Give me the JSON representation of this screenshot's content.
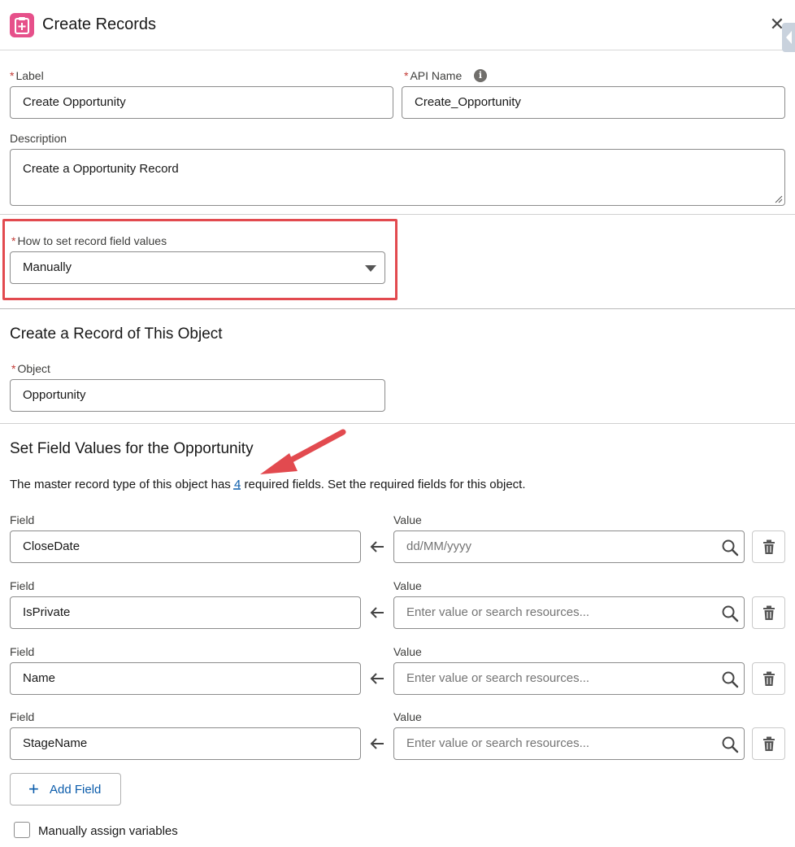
{
  "header": {
    "title": "Create Records",
    "close_symbol": "✕",
    "icon": "create-record-icon",
    "icon_color": "#e6508a"
  },
  "general": {
    "label_field": {
      "label": "Label",
      "value": "Create Opportunity"
    },
    "api_name_field": {
      "label": "API Name",
      "value": "Create_Opportunity",
      "info_icon": "i"
    },
    "description_field": {
      "label": "Description",
      "value": "Create a Opportunity Record"
    },
    "required_marker": "*"
  },
  "how_to_set": {
    "label": "How to set record field values",
    "selected": "Manually",
    "highlight_color": "#e24a4f"
  },
  "object_section": {
    "title": "Create a Record of This Object",
    "object_field": {
      "label": "Object",
      "value": "Opportunity"
    }
  },
  "field_values_section": {
    "title": "Set Field Values for the Opportunity",
    "info_before": "The master record type of this object has ",
    "info_count": "4",
    "info_after": " required fields. Set the required fields for this object.",
    "field_label": "Field",
    "value_label": "Value",
    "rows": [
      {
        "field": "CloseDate",
        "value_placeholder": "dd/MM/yyyy"
      },
      {
        "field": "IsPrivate",
        "value_placeholder": "Enter value or search resources..."
      },
      {
        "field": "Name",
        "value_placeholder": "Enter value or search resources..."
      },
      {
        "field": "StageName",
        "value_placeholder": "Enter value or search resources..."
      }
    ],
    "add_field_plus": "+",
    "add_field_label": "Add Field"
  },
  "manual_assign": {
    "label": "Manually assign variables",
    "checked": false
  },
  "colors": {
    "brand_blue": "#0b5cab",
    "required_red": "#c23934",
    "annotation_red": "#e24a4f"
  }
}
